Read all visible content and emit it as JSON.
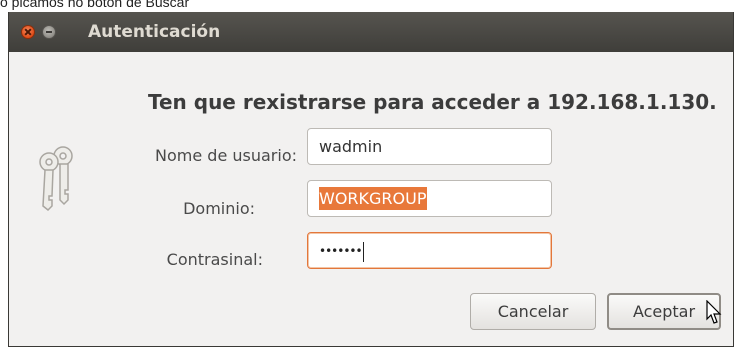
{
  "page": {
    "top_caption": "o picamos no botón de Buscar"
  },
  "window": {
    "title": "Autenticación",
    "close_icon": "close-icon",
    "minimize_icon": "minimize-icon"
  },
  "dialog": {
    "heading": "Ten que rexistrarse para acceder a 192.168.1.130.",
    "icon": "keys-icon",
    "fields": {
      "username": {
        "label": "Nome de usuario:",
        "value": "wadmin"
      },
      "domain": {
        "label": "Dominio:",
        "value": "WORKGROUP"
      },
      "password": {
        "label": "Contrasinal:",
        "value_masked": "•••••••"
      }
    },
    "buttons": {
      "cancel": "Cancelar",
      "accept": "Aceptar"
    }
  },
  "colors": {
    "titlebar": "#4a4945",
    "dialog_background": "#f2f1f0",
    "accent_orange": "#e8783a",
    "close_button": "#df4a16"
  }
}
